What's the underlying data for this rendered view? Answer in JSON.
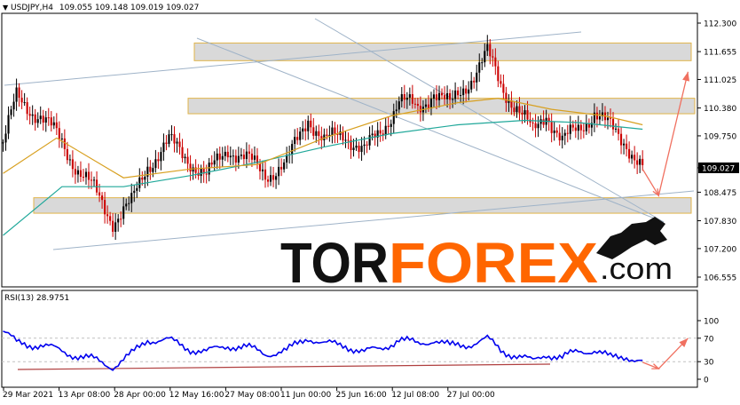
{
  "header": {
    "symbol": "USDJPY,H4",
    "ohlc": "109.055 109.148 109.019 109.027"
  },
  "rsi_header": "RSI(13) 28.9751",
  "watermark": {
    "tor": "TOR",
    "forex": "FOREX",
    "com": ".com"
  },
  "colors": {
    "bull": "#000000",
    "bear": "#cc0000",
    "ma_fast": "#d8a020",
    "ma_slow": "#20a89a",
    "rsi": "#0000ee",
    "arrow": "#f07060",
    "zone_fill": "#d8d8d8",
    "zone_border": "#e0b040",
    "channel": "#9fb3c8",
    "rsi_support": "#b04040",
    "wm_dark": "#111111",
    "wm_orange": "#ff6600"
  },
  "chart_data": {
    "type": "candlestick",
    "symbol": "USDJPY",
    "timeframe": "H4",
    "last_price": "109.027",
    "ylim": [
      106.555,
      112.3
    ],
    "y_ticks": [
      "112.300",
      "111.655",
      "111.025",
      "110.380",
      "109.750",
      "109.027",
      "108.475",
      "107.830",
      "107.200",
      "106.555"
    ],
    "x_labels": [
      "29 Mar 2021",
      "13 Apr 08:00",
      "28 Apr 00:00",
      "12 May 16:00",
      "27 May 08:00",
      "11 Jun 00:00",
      "25 Jun 16:00",
      "12 Jul 08:00",
      "27 Jul 00:00"
    ],
    "price_path": [
      [
        0,
        109.6
      ],
      [
        5,
        110.6
      ],
      [
        14,
        110.2
      ],
      [
        22,
        109.6
      ],
      [
        28,
        109.0
      ],
      [
        34,
        108.5
      ],
      [
        41,
        107.85
      ],
      [
        48,
        108.2
      ],
      [
        54,
        109.1
      ],
      [
        62,
        109.6
      ],
      [
        70,
        109.2
      ],
      [
        76,
        108.8
      ],
      [
        84,
        109.5
      ],
      [
        91,
        109.2
      ],
      [
        98,
        108.9
      ],
      [
        106,
        109.1
      ],
      [
        114,
        110.2
      ],
      [
        120,
        109.6
      ],
      [
        128,
        109.8
      ],
      [
        135,
        109.4
      ],
      [
        141,
        109.8
      ],
      [
        148,
        110.6
      ],
      [
        155,
        110.3
      ],
      [
        161,
        110.8
      ],
      [
        167,
        110.4
      ],
      [
        174,
        111.0
      ],
      [
        181,
        111.6
      ],
      [
        186,
        110.9
      ],
      [
        192,
        110.4
      ],
      [
        198,
        109.8
      ],
      [
        203,
        110.3
      ],
      [
        209,
        109.6
      ],
      [
        215,
        109.9
      ],
      [
        221,
        110.3
      ],
      [
        227,
        109.9
      ],
      [
        233,
        109.6
      ],
      [
        239,
        109.0
      ]
    ],
    "ma_fast": [
      [
        0,
        108.9
      ],
      [
        20,
        109.7
      ],
      [
        45,
        108.8
      ],
      [
        70,
        109.0
      ],
      [
        95,
        109.1
      ],
      [
        120,
        109.7
      ],
      [
        145,
        110.2
      ],
      [
        170,
        110.5
      ],
      [
        185,
        110.6
      ],
      [
        205,
        110.35
      ],
      [
        225,
        110.2
      ],
      [
        239,
        110.0
      ]
    ],
    "ma_slow": [
      [
        0,
        107.5
      ],
      [
        22,
        108.6
      ],
      [
        45,
        108.6
      ],
      [
        70,
        108.85
      ],
      [
        95,
        109.15
      ],
      [
        120,
        109.5
      ],
      [
        145,
        109.8
      ],
      [
        170,
        110.0
      ],
      [
        195,
        110.1
      ],
      [
        215,
        110.05
      ],
      [
        239,
        109.9
      ]
    ],
    "zones": [
      {
        "from": 111.45,
        "to": 111.85
      },
      {
        "from": 110.25,
        "to": 110.6
      },
      {
        "from": 108.0,
        "to": 108.35
      }
    ],
    "forecast_path": [
      [
        239,
        109.0
      ],
      [
        245,
        108.4
      ],
      [
        256,
        111.2
      ]
    ],
    "rsi": {
      "period": 13,
      "value": 28.9751,
      "ylim": [
        0,
        100
      ],
      "levels": [
        "100",
        "70",
        "30",
        "0"
      ],
      "path": [
        [
          0,
          82
        ],
        [
          5,
          62
        ],
        [
          14,
          58
        ],
        [
          22,
          48
        ],
        [
          28,
          40
        ],
        [
          34,
          33
        ],
        [
          41,
          22
        ],
        [
          48,
          42
        ],
        [
          54,
          68
        ],
        [
          62,
          66
        ],
        [
          70,
          52
        ],
        [
          76,
          46
        ],
        [
          84,
          58
        ],
        [
          91,
          54
        ],
        [
          98,
          44
        ],
        [
          106,
          48
        ],
        [
          114,
          72
        ],
        [
          120,
          60
        ],
        [
          128,
          58
        ],
        [
          135,
          46
        ],
        [
          141,
          52
        ],
        [
          148,
          68
        ],
        [
          155,
          60
        ],
        [
          161,
          68
        ],
        [
          167,
          56
        ],
        [
          174,
          60
        ],
        [
          181,
          68
        ],
        [
          186,
          50
        ],
        [
          192,
          40
        ],
        [
          198,
          30
        ],
        [
          203,
          44
        ],
        [
          209,
          36
        ],
        [
          215,
          48
        ],
        [
          221,
          50
        ],
        [
          227,
          36
        ],
        [
          233,
          40
        ],
        [
          239,
          29
        ]
      ],
      "forecast_path": [
        [
          239,
          29
        ],
        [
          245,
          18
        ],
        [
          256,
          70
        ]
      ]
    }
  }
}
